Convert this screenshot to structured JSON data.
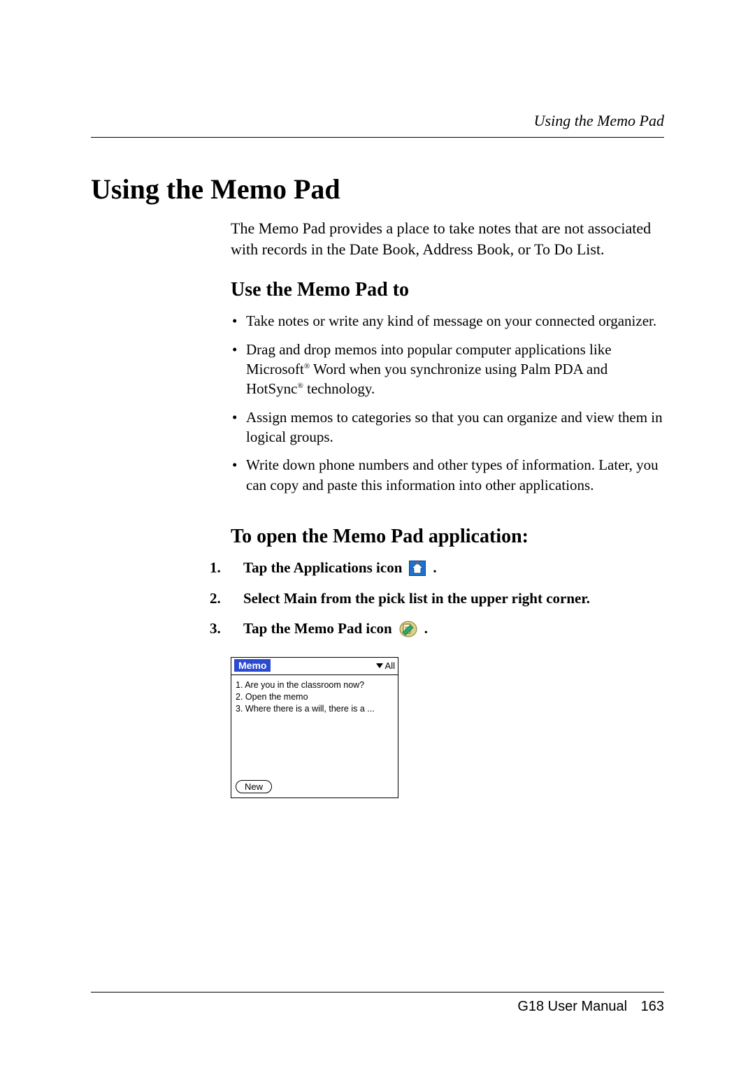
{
  "running_header": "Using the Memo Pad",
  "h1": "Using the Memo Pad",
  "intro": "The Memo Pad provides a place to take notes that are not associated with records in the Date Book, Address Book, or To Do List.",
  "h2a": "Use the Memo Pad to",
  "bullets": {
    "b1": "Take notes or write any kind of message on your connected organizer.",
    "b2a": "Drag and drop memos into popular computer applications like Microsoft",
    "b2b": " Word when you synchronize using Palm PDA and HotSync",
    "b2c": " technology.",
    "b3": "Assign memos to categories so that you can organize and view them in logical groups.",
    "b4": "Write down phone numbers and other types of information. Later, you can copy and paste this information into other applications."
  },
  "reg": "®",
  "h2b": "To open the Memo Pad application:",
  "steps": {
    "n1": "1.",
    "s1": "Tap the Applications icon",
    "n2": "2.",
    "s2": "Select Main from the pick list in the upper right corner.",
    "n3": "3.",
    "s3": "Tap the Memo Pad icon"
  },
  "period": " .",
  "memo": {
    "title": "Memo",
    "picklist": "All",
    "rows": {
      "r1": "1. Are  you in the classroom now?",
      "r2": "2. Open the memo",
      "r3": "3. Where there is a will, there is a ..."
    },
    "new_btn": "New"
  },
  "footer": {
    "manual": "G18 User Manual",
    "page": "163"
  }
}
